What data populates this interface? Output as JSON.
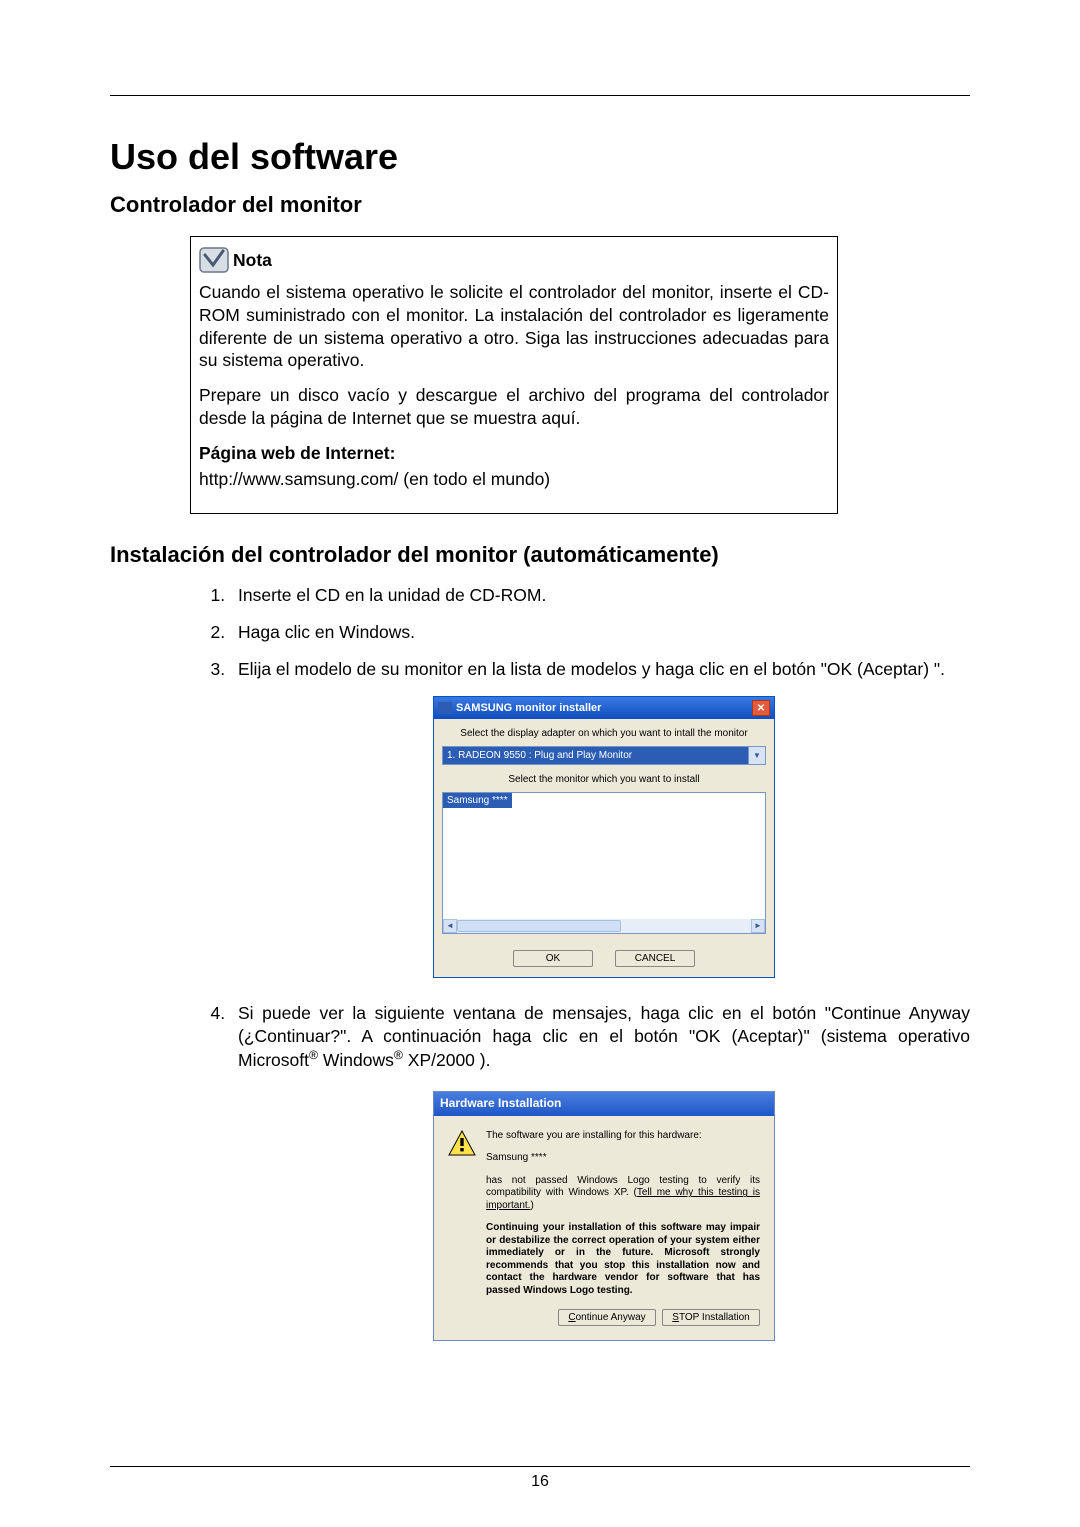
{
  "page": {
    "number": "16"
  },
  "headings": {
    "main": "Uso del software",
    "sub1": "Controlador del monitor",
    "sub2": "Instalación del controlador del monitor (automáticamente)"
  },
  "note": {
    "label": "Nota",
    "para1": "Cuando el sistema operativo le solicite el controlador del monitor, inserte el CD-ROM suministrado con el monitor. La instalación del controlador es ligeramente diferente de un sistema operativo a otro. Siga las instrucciones adecuadas para su sistema operativo.",
    "para2": "Prepare un disco vacío y descargue el archivo del programa del controlador desde la página de Internet que se muestra aquí.",
    "web_label": "Página web de Internet:",
    "url": "http://www.samsung.com/ (en todo el mundo)"
  },
  "steps": {
    "s1": "Inserte el CD en la unidad de CD-ROM.",
    "s2": "Haga clic en Windows.",
    "s3": "Elija el modelo de su monitor en la lista de modelos y haga clic en el botón \"OK (Aceptar) \".",
    "s4_a": "Si puede ver la siguiente ventana de mensajes, haga clic en el botón \"Continue Anyway (¿Continuar?\". A continuación haga clic en el botón \"OK (Aceptar)\" (sistema operativo Microsoft",
    "s4_b": " Windows",
    "s4_c": " XP/2000 )."
  },
  "installer": {
    "title": "SAMSUNG monitor installer",
    "caption1": "Select the display adapter on which you want to intall the monitor",
    "adapter": "1. RADEON 9550 : Plug and Play Monitor",
    "caption2": "Select the monitor which you want to install",
    "selected": "Samsung ****",
    "ok": "OK",
    "cancel": "CANCEL"
  },
  "hw": {
    "title": "Hardware Installation",
    "line1": "The software you are installing for this hardware:",
    "device": "Samsung ****",
    "line2a": "has not passed Windows Logo testing to verify its compatibility with Windows XP. (",
    "link": "Tell me why this testing is important.",
    "line2b": ")",
    "warn": "Continuing your installation of this software may impair or destabilize the correct operation of your system either immediately or in the future. Microsoft strongly recommends that you stop this installation now and contact the hardware vendor for software that has passed Windows Logo testing.",
    "continue": "Continue Anyway",
    "stop": "STOP Installation"
  }
}
